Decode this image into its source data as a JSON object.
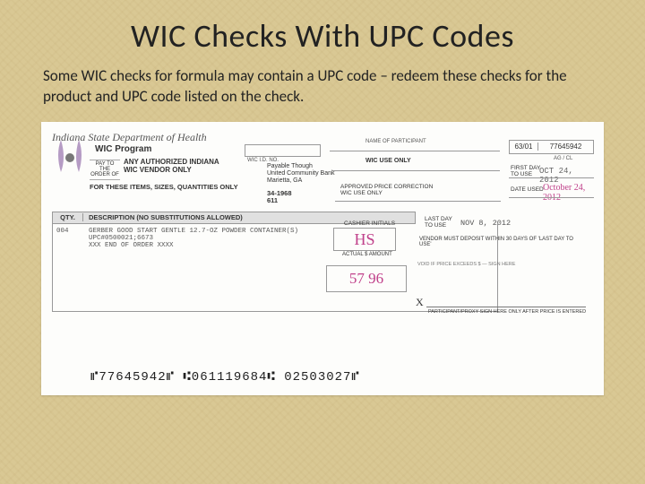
{
  "title": "WIC Checks With UPC Codes",
  "subtitle": "Some WIC checks for formula may contain a UPC code – redeem these checks for the product and UPC code listed on the check.",
  "check": {
    "dept": "Indiana State Department of Health",
    "program": "WIC Program",
    "pay_to_label": "PAY TO THE ORDER OF",
    "vendor_line1": "ANY AUTHORIZED INDIANA",
    "vendor_line2": "WIC VENDOR ONLY",
    "items_only": "FOR THESE ITEMS, SIZES, QUANTITIES ONLY",
    "wic_id_label": "WIC I.D. NO.",
    "payable_l1": "Payable Though",
    "payable_l2": "United Community Bank",
    "payable_l3": "Marietta, GA",
    "routing_l1": "34-1968",
    "routing_l2": "611",
    "name_label": "NAME OF PARTICIPANT",
    "wic_use_only": "WIC USE ONLY",
    "approved_l1": "APPROVED PRICE CORRECTION",
    "approved_l2": "WIC USE ONLY",
    "serial_left": "63/01",
    "serial_right": "77645942",
    "ag_cl": "AG / CL",
    "first_day_lbl": "FIRST DAY\nTO USE",
    "first_day_val": "OCT 24, 2012",
    "date_used_lbl": "DATE USED",
    "date_used_val": "October 24, 2012",
    "last_day_lbl": "LAST DAY\nTO USE",
    "last_day_val": "NOV 8, 2012",
    "deposit_note": "VENDOR MUST DEPOSIT WITHIN 30 DAYS OF 'LAST DAY TO USE'",
    "qty_hdr": "QTY.",
    "desc_hdr": "DESCRIPTION (NO SUBSTITUTIONS ALLOWED)",
    "row_qty": "004",
    "row_desc": "GERBER GOOD START GENTLE 12.7-OZ POWDER CONTAINER(S)",
    "row_upc": "UPC#0500021;6673",
    "row_end": "XXX END OF ORDER XXXX",
    "cashier_lbl": "CASHIER INITIALS",
    "cashier_val": "HS",
    "cashier_under": "ACTUAL $ AMOUNT",
    "amount_val": "57 96",
    "void_note": "VOID IF PRICE EXCEEDS $ — SIGN HERE",
    "sig_x": "X",
    "sig_lbl": "PARTICIPANT/PROXY SIGN HERE ONLY AFTER PRICE IS ENTERED",
    "micr": "⑈77645942⑈  ⑆061119684⑆  02503027⑈"
  }
}
